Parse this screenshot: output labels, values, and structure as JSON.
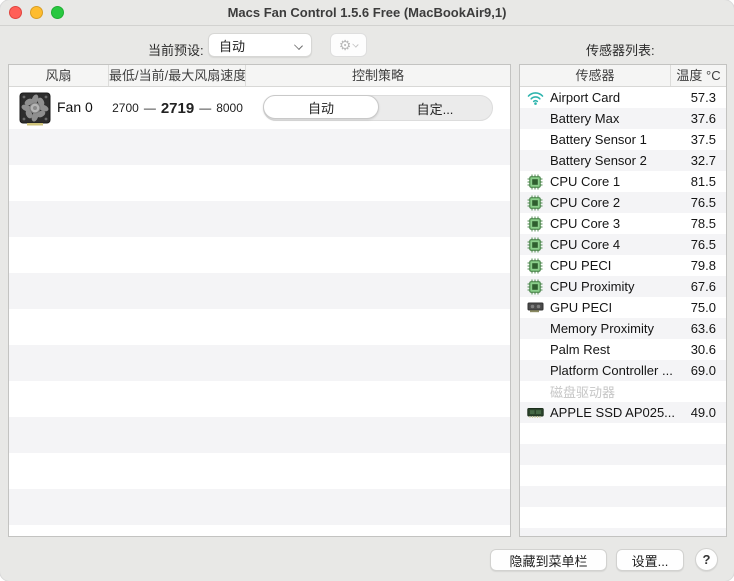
{
  "window": {
    "title": "Macs Fan Control 1.5.6 Free (MacBookAir9,1)"
  },
  "toolbar": {
    "preset_label": "当前预设:",
    "preset_value": "自动",
    "sensor_list_label": "传感器列表:"
  },
  "fan_panel": {
    "columns": [
      "风扇",
      "最低/当前/最大风扇速度",
      "控制策略"
    ],
    "fans": [
      {
        "name": "Fan 0",
        "min": "2700",
        "current": "2719",
        "max": "8000",
        "separator": "—",
        "auto_button": "自动",
        "custom_button": "自定..."
      }
    ]
  },
  "sensor_panel": {
    "columns": {
      "sensor": "传感器",
      "temperature": "温度 °C"
    },
    "rows": [
      {
        "icon": "wifi",
        "name": "Airport Card",
        "temp": "57.3",
        "group": false
      },
      {
        "icon": "",
        "name": "Battery Max",
        "temp": "37.6",
        "group": false
      },
      {
        "icon": "",
        "name": "Battery Sensor 1",
        "temp": "37.5",
        "group": false
      },
      {
        "icon": "",
        "name": "Battery Sensor 2",
        "temp": "32.7",
        "group": false
      },
      {
        "icon": "chip",
        "name": "CPU Core 1",
        "temp": "81.5",
        "group": false
      },
      {
        "icon": "chip",
        "name": "CPU Core 2",
        "temp": "76.5",
        "group": false
      },
      {
        "icon": "chip",
        "name": "CPU Core 3",
        "temp": "78.5",
        "group": false
      },
      {
        "icon": "chip",
        "name": "CPU Core 4",
        "temp": "76.5",
        "group": false
      },
      {
        "icon": "chip",
        "name": "CPU PECI",
        "temp": "79.8",
        "group": false
      },
      {
        "icon": "chip",
        "name": "CPU Proximity",
        "temp": "67.6",
        "group": false
      },
      {
        "icon": "gpu",
        "name": "GPU PECI",
        "temp": "75.0",
        "group": false
      },
      {
        "icon": "",
        "name": "Memory Proximity",
        "temp": "63.6",
        "group": false
      },
      {
        "icon": "",
        "name": "Palm Rest",
        "temp": "30.6",
        "group": false
      },
      {
        "icon": "",
        "name": "Platform Controller ...",
        "temp": "69.0",
        "group": false
      },
      {
        "icon": "",
        "name": "磁盘驱动器",
        "temp": "",
        "group": true
      },
      {
        "icon": "ssd",
        "name": "APPLE SSD AP025...",
        "temp": "49.0",
        "group": false
      }
    ]
  },
  "footer": {
    "hide_button": "隐藏到菜单栏",
    "settings_button": "设置...",
    "help_button": "?"
  },
  "colors": {
    "accent_teal": "#2eb5ae",
    "chip_green": "#8ccf8c",
    "window_bg": "#e8e8e6"
  }
}
